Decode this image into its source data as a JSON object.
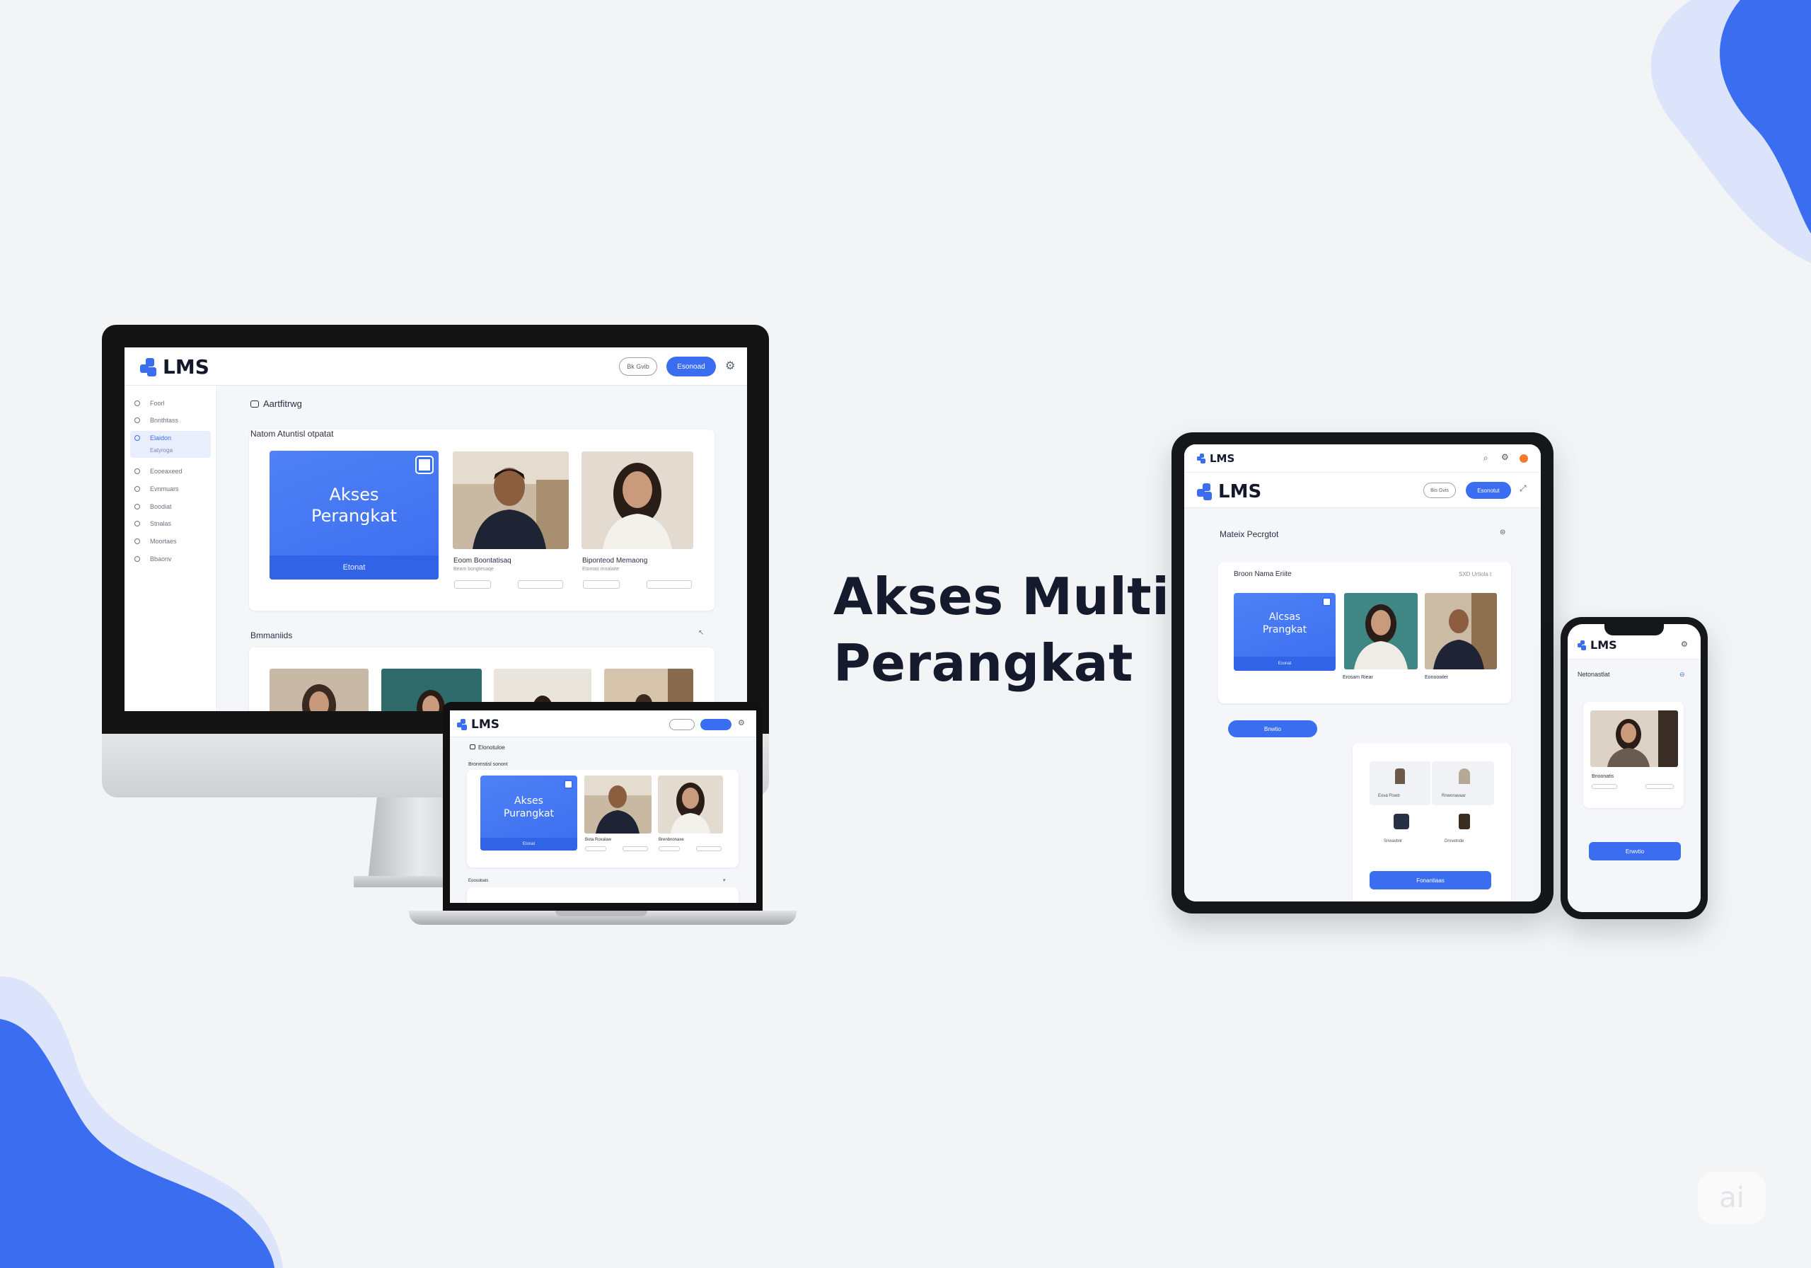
{
  "headline": {
    "line1": "Akses Multi",
    "line2": "Perangkat"
  },
  "colors": {
    "accent": "#3b6df0",
    "background": "#f3f4f6",
    "text": "#151a2c"
  },
  "desktop": {
    "logo": "LMS",
    "header_outline_button": "Bk Gvib",
    "header_primary_button": "Esonoad",
    "header_icon": "gear-icon",
    "page_title": "Aartfitrwg",
    "sidebar": [
      "Foorl",
      "Bnnthtass",
      "Elaidon",
      "Eatyroga",
      "Eooeaxeed",
      "Evnmuars",
      "Boodiat",
      "Stnalas",
      "Moortaes",
      "Bbaonv"
    ],
    "section1_title": "Natom Atuntisl otpatat",
    "hero_title_1": "Akses",
    "hero_title_2": "Perangkat",
    "hero_button": "Etonat",
    "card2_caption": "Eoom Boontatisaq",
    "card2_sub": "Beam bongtesaqe",
    "card3_caption": "Biponteod Memaong",
    "card3_sub": "Etontas mnalaite",
    "section2_title": "Bmmaniids"
  },
  "laptop": {
    "logo": "LMS",
    "page_title": "Elonotuloe",
    "section_title": "Bronmstisl sonont",
    "hero_title_1": "Akses",
    "hero_title_2": "Purangkat",
    "hero_button": "Etonat",
    "card2_caption": "Bota Roxalaw",
    "card3_caption": "Brenbnonaxe",
    "section2_title": "Eoosobats"
  },
  "tablet": {
    "topbar_logo": "LMS",
    "logo": "LMS",
    "header_outline_button": "Bis Gvis",
    "header_primary_button": "Esonotut",
    "page_title": "Mateix Pecrgtot",
    "card_title": "Broon Nama Eriite",
    "card_meta": "SXD Urtiola t",
    "hero_title_1": "Alcsas",
    "hero_title_2": "Prangkat",
    "hero_button": "Esonat",
    "card2_caption": "Erosam Riear",
    "card3_caption": "Eonoowler",
    "blue_button": "Bnwtio",
    "grid_items": [
      "Eova Ftoeb",
      "Rnwonavaar",
      "Snwavbiir",
      "Drvvetnde"
    ],
    "bottom_button": "Fonantiaas"
  },
  "phone": {
    "logo": "LMS",
    "page_title": "Netonastlat",
    "card_caption": "Bnoonatis",
    "button": "Erwvtio"
  },
  "watermark": "ai"
}
